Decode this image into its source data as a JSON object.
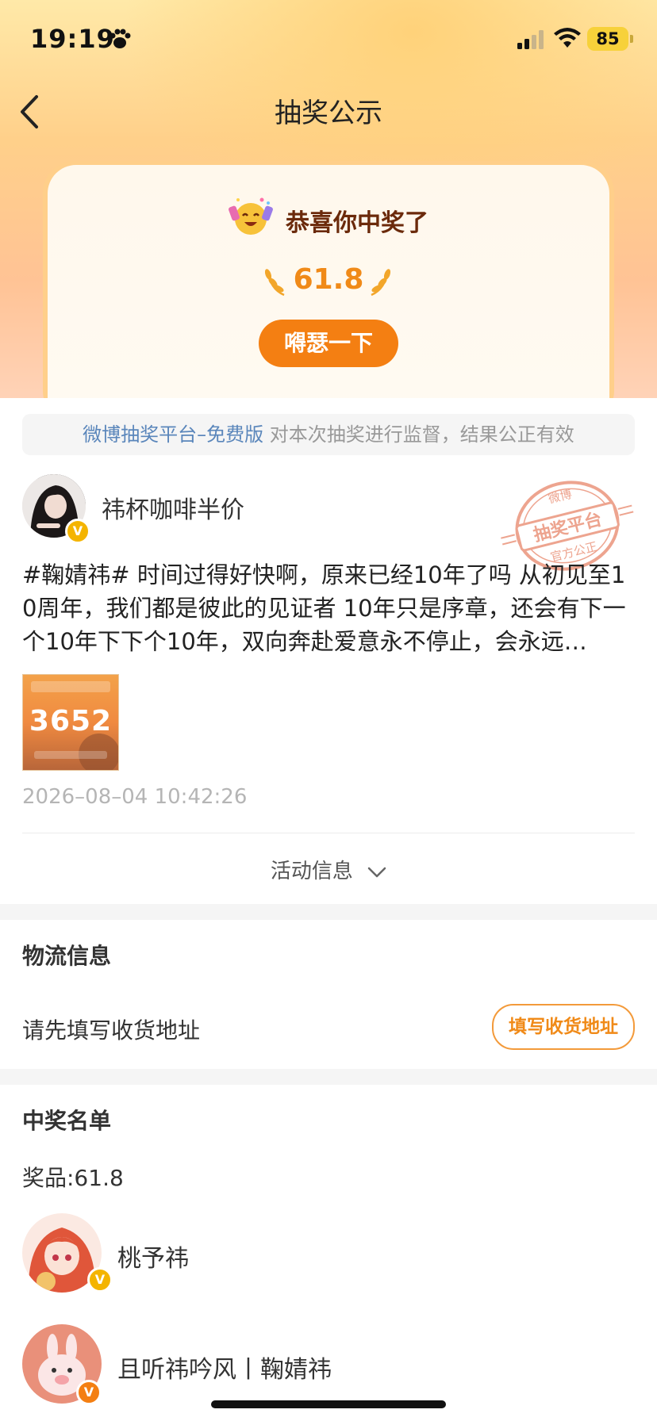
{
  "status_bar": {
    "time": "19:19",
    "battery": "85"
  },
  "nav": {
    "title": "抽奖公示"
  },
  "prize_card": {
    "congrats": "恭喜你中奖了",
    "amount": "61.8",
    "show_off_label": "嘚瑟一下"
  },
  "notice": {
    "platform_link": "微博抽奖平台–免费版",
    "text": " 对本次抽奖进行监督，结果公正有效"
  },
  "post": {
    "author": "祎杯咖啡半价",
    "text": "#鞠婧祎# 时间过得好快啊，原来已经10年了吗 从初见至10周年，我们都是彼此的见证者 10年只是序章，还会有下一个10年下下个10年，双向奔赴爱意永不停止，会永远…",
    "image": {
      "number": "3652"
    },
    "time": "2026–08–04 10:42:26",
    "stamp": {
      "top": "微博",
      "middle": "抽奖平台",
      "bottom": "官方公正"
    }
  },
  "activity": {
    "label": "活动信息"
  },
  "logistics": {
    "title": "物流信息",
    "hint": "请先填写收货地址",
    "button": "填写收货地址"
  },
  "winners": {
    "title": "中奖名单",
    "prize_label": "奖品:61.8",
    "list": [
      {
        "name": "桃予祎"
      },
      {
        "name": "且听祎吟风丨鞠婧祎"
      }
    ]
  },
  "colors": {
    "accent": "#f47f12",
    "link": "#5a86bb",
    "badge": "#f4b400"
  }
}
